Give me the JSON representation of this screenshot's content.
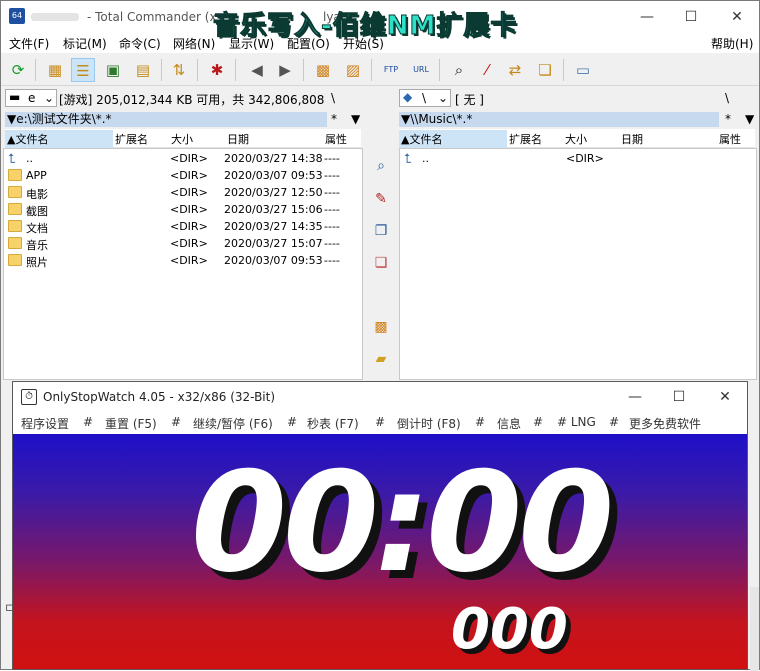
{
  "overlay_title": "音乐写入-佰维NM扩展卡",
  "tc": {
    "title": "- Total Commander (x",
    "title_tail": "lya",
    "menu": [
      "文件(F)",
      "标记(M)",
      "命令(C)",
      "网络(N)",
      "显示(W)",
      "配置(O)",
      "开始(S)",
      "帮助(H)"
    ],
    "left": {
      "drive": "e",
      "drive_info": "[游戏]  205,012,344 KB 可用，共 342,806,808",
      "root": "\\",
      "path": "▼e:\\测试文件夹\\*.*",
      "star": "*",
      "headers": [
        "▲文件名",
        "扩展名",
        "大小",
        "日期",
        "属性"
      ],
      "rows": [
        {
          "name": "..",
          "size": "<DIR>",
          "date": "2020/03/27 14:38",
          "attr": "----",
          "up": true
        },
        {
          "name": "APP",
          "size": "<DIR>",
          "date": "2020/03/07 09:53",
          "attr": "----"
        },
        {
          "name": "电影",
          "size": "<DIR>",
          "date": "2020/03/27 12:50",
          "attr": "----"
        },
        {
          "name": "截图",
          "size": "<DIR>",
          "date": "2020/03/27 15:06",
          "attr": "----"
        },
        {
          "name": "文档",
          "size": "<DIR>",
          "date": "2020/03/27 14:35",
          "attr": "----"
        },
        {
          "name": "音乐",
          "size": "<DIR>",
          "date": "2020/03/27 15:07",
          "attr": "----"
        },
        {
          "name": "照片",
          "size": "<DIR>",
          "date": "2020/03/07 09:53",
          "attr": "----"
        }
      ]
    },
    "right": {
      "drive": "\\",
      "drive_info": "[ 无 ]",
      "root": "\\",
      "path": "▼\\\\Music\\*.*",
      "star": "*",
      "headers": [
        "▲文件名",
        "扩展名",
        "大小",
        "日期",
        "属性"
      ],
      "rows": [
        {
          "name": "..",
          "size": "<DIR>",
          "date": "",
          "attr": "",
          "up": true
        }
      ]
    }
  },
  "stopwatch": {
    "title": "OnlyStopWatch 4.05 - x32/x86 (32-Bit)",
    "menu": [
      "程序设置",
      "#",
      "重置 (F5)",
      "#",
      "继续/暂停 (F6)",
      "#",
      "秒表 (F7)",
      "#",
      "倒计时 (F8)",
      "#",
      "信息",
      "#",
      "# LNG",
      "#",
      "更多免费软件"
    ],
    "time": "00:00",
    "ms": "000"
  }
}
